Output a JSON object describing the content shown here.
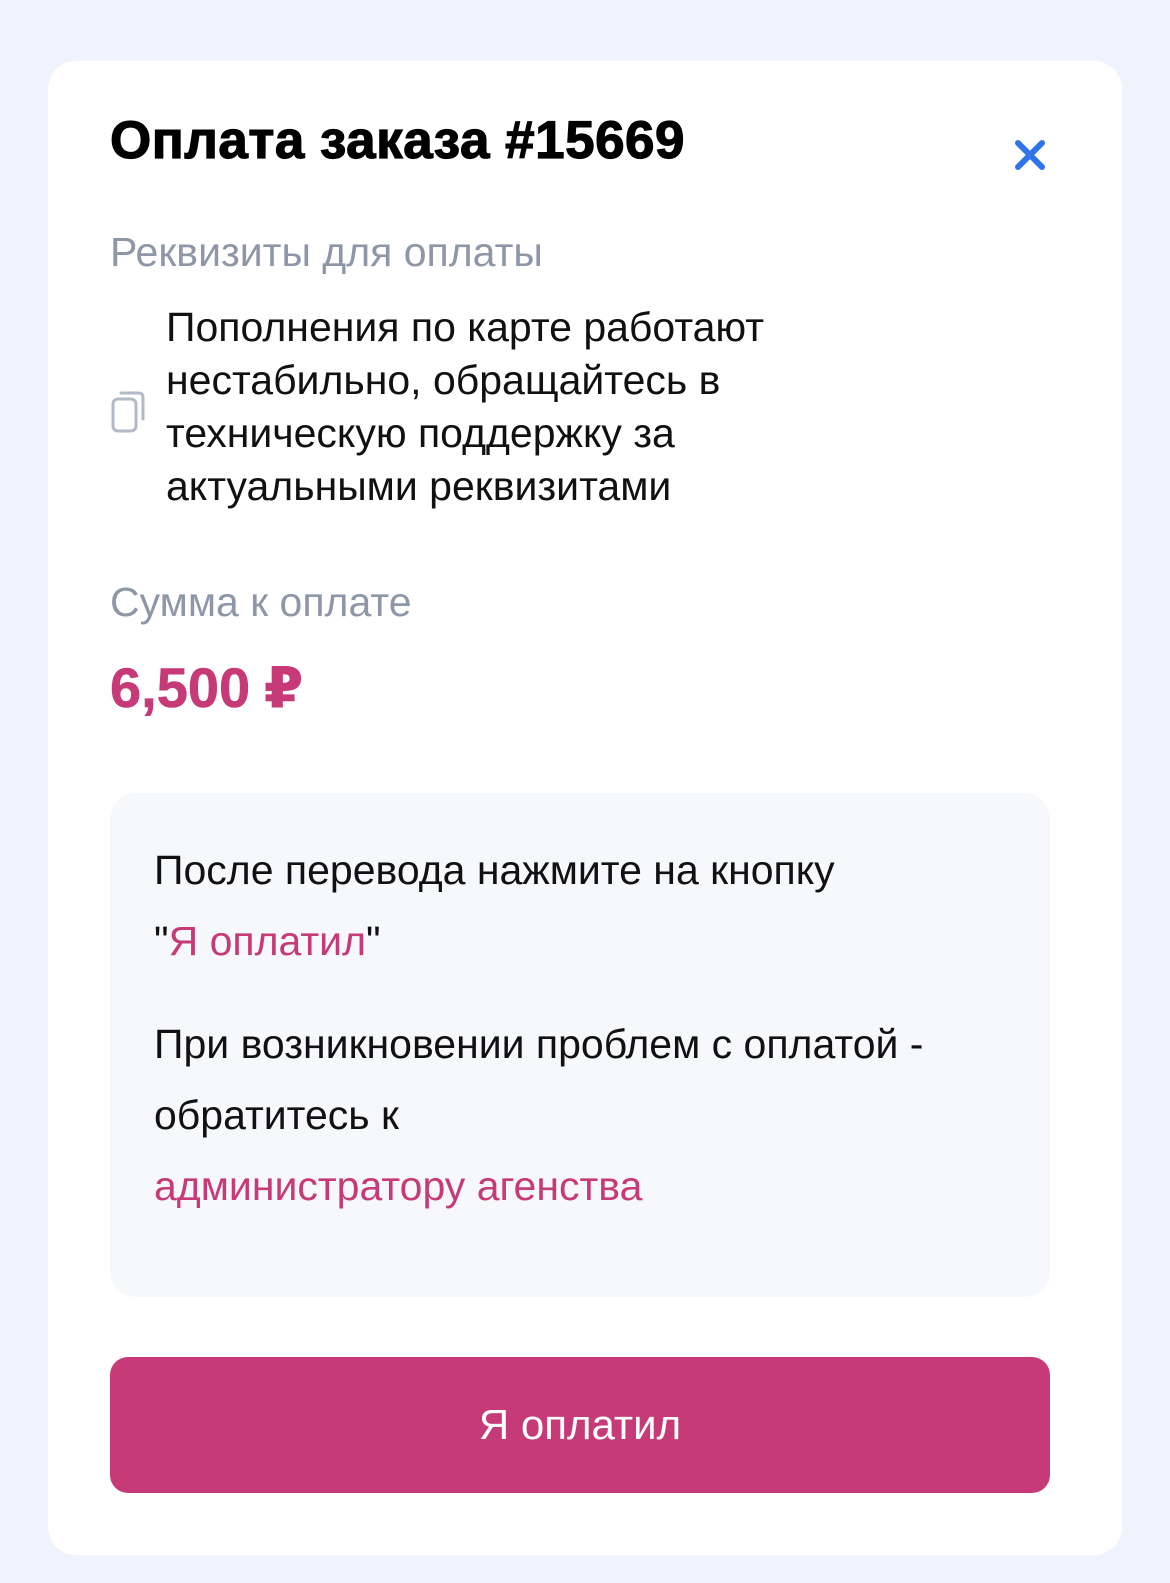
{
  "modal": {
    "title": "Оплата заказа #15669",
    "close_icon": "close-icon",
    "colors": {
      "accent": "#c63a77",
      "close": "#2f74e8",
      "page_background": "#eef3fe",
      "muted_label": "#8e97a8"
    }
  },
  "requisites": {
    "label": "Реквизиты для оплаты",
    "copy_icon": "copy-icon",
    "text": "Пополнения по карте работают нестабильно, обращайтесь в техническую поддержку за актуальными реквизитами"
  },
  "amount": {
    "label": "Сумма к оплате",
    "value": "6,500",
    "currency": "₽"
  },
  "info": {
    "line1_prefix": "После перевода нажмите на кнопку",
    "line1_quote_open": "\"",
    "line1_highlight": "Я оплатил",
    "line1_quote_close": "\"",
    "line2_prefix": "При возникновении проблем с оплатой - обратитесь к",
    "line2_link": "администратору агенства"
  },
  "pay_button": {
    "label": "Я оплатил"
  }
}
